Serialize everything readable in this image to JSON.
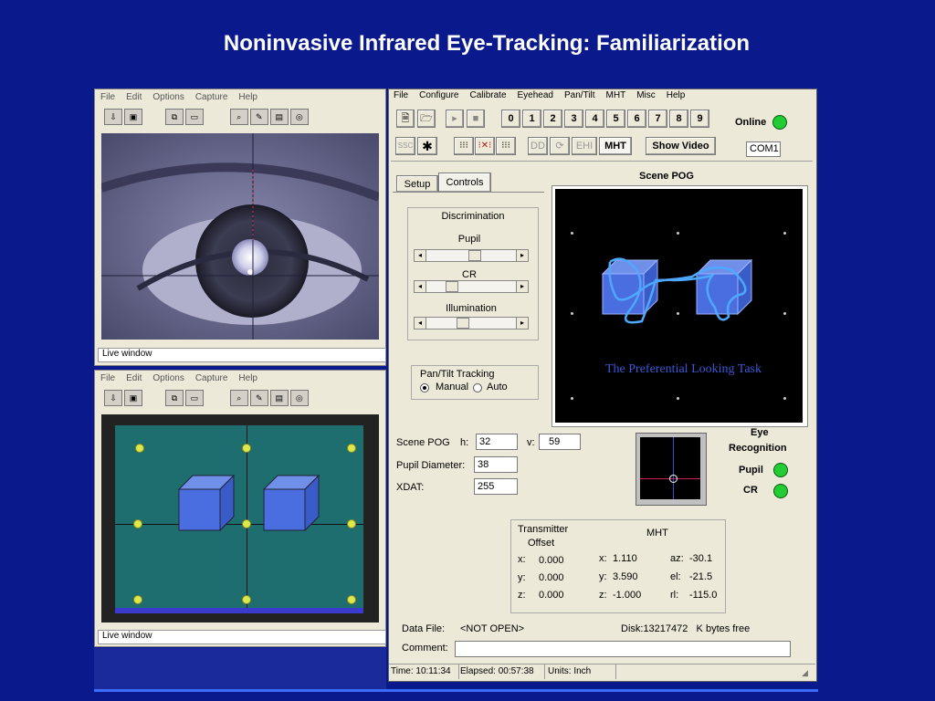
{
  "slide_title": "Noninvasive Infrared Eye-Tracking: Familiarization",
  "video_window": {
    "menu": [
      "File",
      "Edit",
      "Options",
      "Capture",
      "Help"
    ],
    "live_label_top": "Live window",
    "live_label_bottom": "Live window"
  },
  "control_app": {
    "menu": [
      "File",
      "Configure",
      "Calibrate",
      "Eyehead",
      "Pan/Tilt",
      "MHT",
      "Misc",
      "Help"
    ],
    "number_buttons": [
      "0",
      "1",
      "2",
      "3",
      "4",
      "5",
      "6",
      "7",
      "8",
      "9"
    ],
    "online_label": "Online",
    "com_port": "COM1",
    "toolbar2": {
      "ssc": "SSC",
      "dd": "DD",
      "ehi": "EHI",
      "mht": "MHT",
      "show_video": "Show Video"
    },
    "tabs": [
      "Setup",
      "Controls"
    ],
    "discrimination": {
      "title": "Discrimination",
      "pupil": "Pupil",
      "cr": "CR",
      "illumination": "Illumination",
      "pupil_level": 0.55,
      "cr_level": 0.25,
      "illumination_level": 0.4
    },
    "pan_tilt": {
      "title": "Pan/Tilt Tracking",
      "manual": "Manual",
      "auto": "Auto"
    },
    "scene_pog_title": "Scene POG",
    "scene_caption": "The Preferential Looking Task",
    "readouts": {
      "scene_pog": "Scene POG",
      "h_label": "h:",
      "h_value": "32",
      "v_label": "v:",
      "v_value": "59",
      "pupil_diameter_label": "Pupil Diameter:",
      "pupil_diameter": "38",
      "xdat_label": "XDAT:",
      "xdat": "255"
    },
    "eye_recognition": {
      "title_line1": "Eye",
      "title_line2": "Recognition",
      "pupil": "Pupil",
      "cr": "CR"
    },
    "transmitter": {
      "title_line1": "Transmitter",
      "title_line2": "Offset",
      "x_label": "x:",
      "x": "0.000",
      "y_label": "y:",
      "y": "0.000",
      "z_label": "z:",
      "z": "0.000"
    },
    "mht": {
      "title": "MHT",
      "x_label": "x:",
      "x": "1.110",
      "y_label": "y:",
      "y": "3.590",
      "z_label": "z:",
      "z": "-1.000",
      "az_label": "az:",
      "az": "-30.1",
      "el_label": "el:",
      "el": "-21.5",
      "rl_label": "rl:",
      "rl": "-115.0"
    },
    "data_file_label": "Data File:",
    "data_file": "<NOT OPEN>",
    "disk": "Disk:13217472   K bytes free",
    "comment_label": "Comment:",
    "status": {
      "time": "Time: 10:11:34",
      "elapsed": "Elapsed: 00:57:38",
      "units": "Units: Inch"
    }
  },
  "colors": {
    "slide_bg": "#0a1a8c",
    "window_bg": "#ece9d8",
    "led_green": "#22cc33",
    "scene_caption": "#3a58d8",
    "teal_screen": "#1e6e70"
  }
}
